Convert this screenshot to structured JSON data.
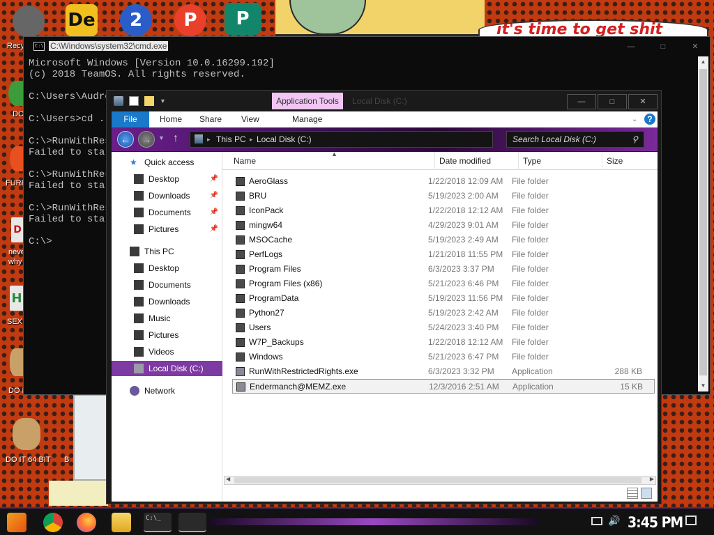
{
  "desktop": {
    "banner_text": "it's time to get shit",
    "icon_labels": [
      "Recy",
      "DO",
      "FURR",
      "neve",
      "why",
      "SEX",
      "DO I",
      "DO I",
      "DO IT 64 BIT",
      "B"
    ]
  },
  "cmd": {
    "title": "C:\\Windows\\system32\\cmd.exe",
    "icon": "C:\\",
    "lines": [
      "Microsoft Windows [Version 10.0.16299.192]",
      "(c) 2018 TeamOS. All rights reserved.",
      "",
      "C:\\Users\\Audre",
      "",
      "C:\\Users>cd ..",
      "",
      "C:\\>RunWithRes",
      "Failed to star",
      "",
      "C:\\>RunWithRes",
      "Failed to star",
      "",
      "C:\\>RunWithRes",
      "Failed to star",
      "",
      "C:\\>"
    ]
  },
  "explorer": {
    "title": "Local Disk (C:)",
    "app_tools": "Application Tools",
    "ribbon_tabs": [
      "File",
      "Home",
      "Share",
      "View",
      "Manage"
    ],
    "address": [
      "This PC",
      "Local Disk (C:)"
    ],
    "search_placeholder": "Search Local Disk (C:)",
    "nav": [
      {
        "label": "Quick access",
        "icon": "star-icon",
        "pinned": false,
        "indent": 0,
        "selected": false
      },
      {
        "label": "Desktop",
        "icon": "desktop-icon",
        "pinned": true,
        "indent": 1,
        "selected": false
      },
      {
        "label": "Downloads",
        "icon": "downloads-icon",
        "pinned": true,
        "indent": 1,
        "selected": false
      },
      {
        "label": "Documents",
        "icon": "documents-icon",
        "pinned": true,
        "indent": 1,
        "selected": false
      },
      {
        "label": "Pictures",
        "icon": "pictures-icon",
        "pinned": true,
        "indent": 1,
        "selected": false
      },
      {
        "label": "This PC",
        "icon": "computer-icon",
        "pinned": false,
        "indent": 0,
        "selected": false
      },
      {
        "label": "Desktop",
        "icon": "desktop-icon",
        "pinned": false,
        "indent": 1,
        "selected": false
      },
      {
        "label": "Documents",
        "icon": "documents-icon",
        "pinned": false,
        "indent": 1,
        "selected": false
      },
      {
        "label": "Downloads",
        "icon": "downloads-icon",
        "pinned": false,
        "indent": 1,
        "selected": false
      },
      {
        "label": "Music",
        "icon": "music-icon",
        "pinned": false,
        "indent": 1,
        "selected": false
      },
      {
        "label": "Pictures",
        "icon": "pictures-icon",
        "pinned": false,
        "indent": 1,
        "selected": false
      },
      {
        "label": "Videos",
        "icon": "videos-icon",
        "pinned": false,
        "indent": 1,
        "selected": false
      },
      {
        "label": "Local Disk (C:)",
        "icon": "drive-icon",
        "pinned": false,
        "indent": 1,
        "selected": true
      },
      {
        "label": "Network",
        "icon": "network-icon",
        "pinned": false,
        "indent": 0,
        "selected": false
      }
    ],
    "columns": [
      "Name",
      "Date modified",
      "Type",
      "Size"
    ],
    "files": [
      {
        "name": "AeroGlass",
        "date": "1/22/2018 12:09 AM",
        "type": "File folder",
        "size": "",
        "icon": "folder-icon"
      },
      {
        "name": "BRU",
        "date": "5/19/2023 2:00 AM",
        "type": "File folder",
        "size": "",
        "icon": "folder-icon"
      },
      {
        "name": "IconPack",
        "date": "1/22/2018 12:12 AM",
        "type": "File folder",
        "size": "",
        "icon": "folder-icon"
      },
      {
        "name": "mingw64",
        "date": "4/29/2023 9:01 AM",
        "type": "File folder",
        "size": "",
        "icon": "folder-icon"
      },
      {
        "name": "MSOCache",
        "date": "5/19/2023 2:49 AM",
        "type": "File folder",
        "size": "",
        "icon": "folder-icon"
      },
      {
        "name": "PerfLogs",
        "date": "1/21/2018 11:55 PM",
        "type": "File folder",
        "size": "",
        "icon": "folder-icon"
      },
      {
        "name": "Program Files",
        "date": "6/3/2023 3:37 PM",
        "type": "File folder",
        "size": "",
        "icon": "folder-icon"
      },
      {
        "name": "Program Files (x86)",
        "date": "5/21/2023 6:46 PM",
        "type": "File folder",
        "size": "",
        "icon": "folder-icon"
      },
      {
        "name": "ProgramData",
        "date": "5/19/2023 11:56 PM",
        "type": "File folder",
        "size": "",
        "icon": "folder-icon"
      },
      {
        "name": "Python27",
        "date": "5/19/2023 2:42 AM",
        "type": "File folder",
        "size": "",
        "icon": "folder-icon"
      },
      {
        "name": "Users",
        "date": "5/24/2023 3:40 PM",
        "type": "File folder",
        "size": "",
        "icon": "folder-icon"
      },
      {
        "name": "W7P_Backups",
        "date": "1/22/2018 12:12 AM",
        "type": "File folder",
        "size": "",
        "icon": "folder-icon"
      },
      {
        "name": "Windows",
        "date": "5/21/2023 6:47 PM",
        "type": "File folder",
        "size": "",
        "icon": "folder-icon"
      },
      {
        "name": "RunWithRestrictedRights.exe",
        "date": "6/3/2023 3:32 PM",
        "type": "Application",
        "size": "288 KB",
        "icon": "app-icon"
      },
      {
        "name": "Endermanch@MEMZ.exe",
        "date": "12/3/2016 2:51 AM",
        "type": "Application",
        "size": "15 KB",
        "icon": "app-icon",
        "selected": true
      }
    ]
  },
  "taskbar": {
    "clock": "3:45 PM",
    "apps": [
      "start-icon",
      "chrome-icon",
      "firefox-icon",
      "file-explorer-icon",
      "cmd-icon",
      "app-icon"
    ]
  },
  "colors": {
    "accent_purple": "#7e3aa3",
    "file_tab_blue": "#1979ca",
    "app_tools_pink": "#f1c5f4"
  }
}
